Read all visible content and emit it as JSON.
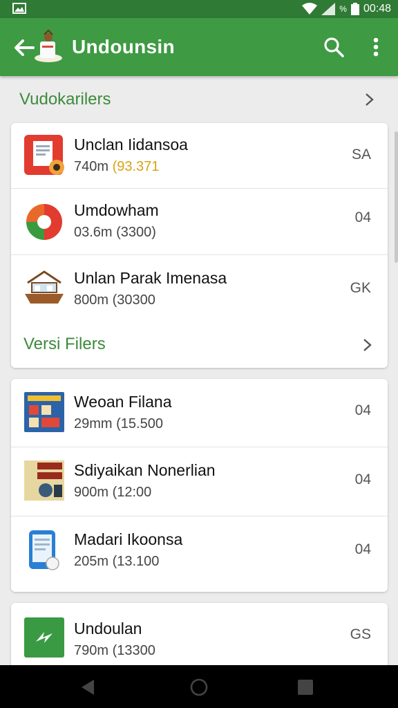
{
  "status": {
    "time": "00:48",
    "battery_pct": "%"
  },
  "appbar": {
    "title": "Undounsin",
    "icons": [
      "back-arrow-icon",
      "app-logo-icon",
      "search-icon",
      "more-vert-icon"
    ]
  },
  "section1": {
    "label": "Vudokarilers"
  },
  "card1": {
    "items": [
      {
        "name": "Unclan Iidansoa",
        "meta_prefix": "740m ",
        "meta_highlight": "(93.371",
        "badge": "SA",
        "icon": "document-app-icon"
      },
      {
        "name": "Umdowham",
        "meta_prefix": "03.6m (3300)",
        "meta_highlight": "",
        "badge": "04",
        "icon": "colorful-logo-icon"
      },
      {
        "name": "Unlan Parak Imenasa",
        "meta_prefix": "800m (30300",
        "meta_highlight": "",
        "badge": "GK",
        "icon": "boat-house-icon"
      }
    ],
    "link_label": "Versi Filers"
  },
  "card2": {
    "items": [
      {
        "name": "Weoan Filana",
        "meta": "29mm (15.500",
        "badge": "04",
        "icon": "poster-icon"
      },
      {
        "name": "Sdiyaikan Nonerlian",
        "meta": "900m (12:00",
        "badge": "04",
        "icon": "stamp-icon"
      },
      {
        "name": "Madari Ikoonsa",
        "meta": "205m (13.100",
        "badge": "04",
        "icon": "phone-doc-icon"
      }
    ]
  },
  "card3": {
    "items": [
      {
        "name": "Undoulan",
        "meta": "790m (13300",
        "badge": "GS",
        "icon": "green-app-icon"
      }
    ]
  },
  "navbar": {
    "icons": [
      "back-triangle-icon",
      "home-circle-icon",
      "recents-square-icon"
    ]
  },
  "colors": {
    "appbar": "#3e9a43",
    "statusbar": "#2f7a34",
    "accent_text": "#3c8a3c",
    "highlight": "#d7a315"
  }
}
